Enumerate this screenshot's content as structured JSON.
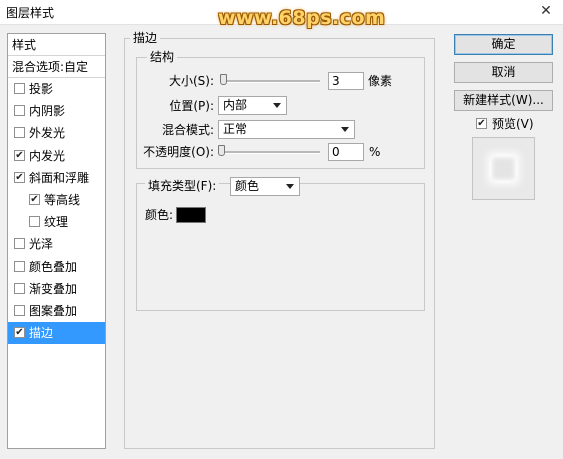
{
  "window": {
    "title": "图层样式",
    "watermark": "www.68ps.com",
    "close_glyph": "✕"
  },
  "style_list": {
    "header": "样式",
    "blend_options": "混合选项:自定",
    "items": [
      {
        "label": "投影",
        "checked": false
      },
      {
        "label": "内阴影",
        "checked": false
      },
      {
        "label": "外发光",
        "checked": false
      },
      {
        "label": "内发光",
        "checked": true
      },
      {
        "label": "斜面和浮雕",
        "checked": true
      },
      {
        "label": "等高线",
        "checked": true,
        "sub": true
      },
      {
        "label": "纹理",
        "checked": false,
        "sub": true
      },
      {
        "label": "光泽",
        "checked": false
      },
      {
        "label": "颜色叠加",
        "checked": false
      },
      {
        "label": "渐变叠加",
        "checked": false
      },
      {
        "label": "图案叠加",
        "checked": false
      },
      {
        "label": "描边",
        "checked": true,
        "selected": true
      }
    ]
  },
  "stroke": {
    "section_title": "描边",
    "structure_title": "结构",
    "size_label": "大小(S):",
    "size_value": "3",
    "size_unit": "像素",
    "position_label": "位置(P):",
    "position_value": "内部",
    "blend_mode_label": "混合模式:",
    "blend_mode_value": "正常",
    "opacity_label": "不透明度(O):",
    "opacity_value": "0",
    "opacity_unit": "%",
    "fill_type_label": "填充类型(F):",
    "fill_type_value": "颜色",
    "color_label": "颜色:",
    "color_value": "#000000"
  },
  "buttons": {
    "ok": "确定",
    "cancel": "取消",
    "new_style": "新建样式(W)...",
    "preview_label": "预览(V)",
    "preview_checked": true
  }
}
